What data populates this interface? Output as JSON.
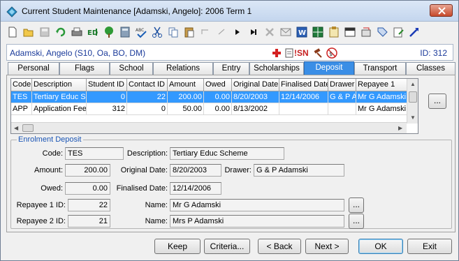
{
  "window": {
    "title": "Current Student Maintenance  [Adamski, Angelo]: 2006 Term 1"
  },
  "toolbar": {
    "buttons": [
      "new-icon",
      "open-icon",
      "save-icon",
      "refresh-icon",
      "print-icon",
      "id-icon",
      "tree-icon",
      "calculator-icon",
      "spellcheck-icon",
      "cut-icon",
      "copy-icon",
      "paste-icon",
      "undo-icon",
      "redo-icon",
      "next-icon",
      "last-icon",
      "delete-icon",
      "email-icon",
      "word-icon",
      "grid-icon",
      "clipboard-icon",
      "calendar-icon",
      "report-icon",
      "tag-icon",
      "notes-icon",
      "arrow-icon"
    ]
  },
  "student": {
    "name": "Adamski, Angelo (S10, Oa, BO, DM)",
    "sn_flag": "!SN",
    "id_label": "ID: 312"
  },
  "tabs": [
    "Personal",
    "Flags",
    "School",
    "Relations",
    "Entry",
    "Scholarships",
    "Deposit",
    "Transport",
    "Classes"
  ],
  "active_tab": "Deposit",
  "grid": {
    "columns": [
      "Code",
      "Description",
      "Student ID",
      "Contact ID",
      "Amount",
      "Owed",
      "Original Date",
      "Finalised Date",
      "Drawer",
      "Repayee 1"
    ],
    "rows": [
      [
        "TES",
        "Tertiary Educ S",
        "0",
        "22",
        "200.00",
        "0.00",
        "8/20/2003",
        "12/14/2006",
        "G & P Ad",
        "Mr G Adamski"
      ],
      [
        "APP",
        "Application Fee",
        "312",
        "0",
        "50.00",
        "0.00",
        "8/13/2002",
        "",
        "",
        "Mr G Adamski"
      ]
    ],
    "ellipsis": "..."
  },
  "enrolment": {
    "group_title": "Enrolment Deposit",
    "code_label": "Code:",
    "code": "TES",
    "description_label": "Description:",
    "description": "Tertiary Educ Scheme",
    "amount_label": "Amount:",
    "amount": "200.00",
    "original_date_label": "Original Date:",
    "original_date": "8/20/2003",
    "drawer_label": "Drawer:",
    "drawer": "G & P Adamski",
    "owed_label": "Owed:",
    "owed": "0.00",
    "finalised_date_label": "Finalised Date:",
    "finalised_date": "12/14/2006",
    "repayee1_id_label": "Repayee 1 ID:",
    "repayee1_id": "22",
    "name_label": "Name:",
    "repayee1_name": "Mr G Adamski",
    "repayee2_id_label": "Repayee 2 ID:",
    "repayee2_id": "21",
    "repayee2_name": "Mrs P Adamski",
    "ellipsis": "..."
  },
  "buttons": {
    "keep": "Keep",
    "criteria": "Criteria...",
    "back": "< Back",
    "next": "Next >",
    "ok": "OK",
    "exit": "Exit"
  }
}
